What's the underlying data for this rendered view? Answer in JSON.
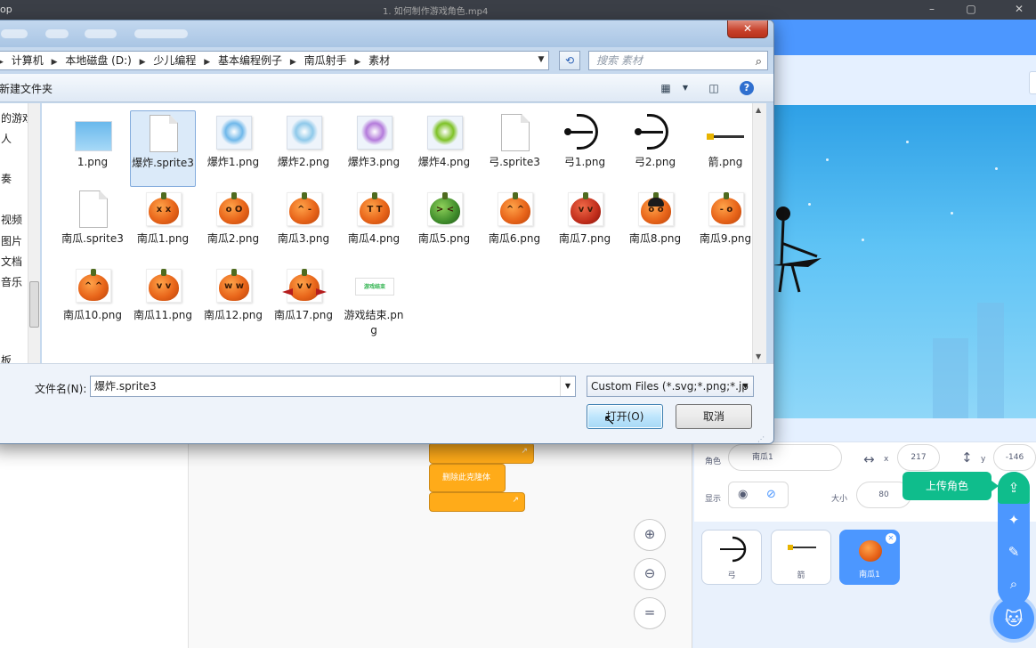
{
  "window": {
    "app_title_fragment": "op",
    "title_blurred": "1. 如何制作游戏角色.mp4"
  },
  "dialog": {
    "close_label": "✕",
    "breadcrumbs": [
      "计算机",
      "本地磁盘 (D:)",
      "少儿编程",
      "基本编程例子",
      "南瓜射手",
      "素材"
    ],
    "search_placeholder": "搜索 素材",
    "new_folder_label": "新建文件夹",
    "nav_items": [
      "的游戏",
      "人",
      "奏",
      "视频",
      "图片",
      "文档",
      "音乐",
      "板"
    ],
    "files": [
      {
        "name": "1.png",
        "kind": "sky"
      },
      {
        "name": "爆炸.sprite3",
        "kind": "doc",
        "selected": true
      },
      {
        "name": "爆炸1.png",
        "kind": "splash",
        "color": "#6fb8ea"
      },
      {
        "name": "爆炸2.png",
        "kind": "splash",
        "color": "#8ec9ea"
      },
      {
        "name": "爆炸3.png",
        "kind": "splash",
        "color": "#b47bdb"
      },
      {
        "name": "爆炸4.png",
        "kind": "splash",
        "color": "#7ec226"
      },
      {
        "name": "弓.sprite3",
        "kind": "doc"
      },
      {
        "name": "弓1.png",
        "kind": "bow"
      },
      {
        "name": "弓2.png",
        "kind": "bow"
      },
      {
        "name": "箭.png",
        "kind": "arrow"
      },
      {
        "name": "南瓜.sprite3",
        "kind": "doc"
      },
      {
        "name": "南瓜1.png",
        "kind": "pumpkin",
        "face": "x x"
      },
      {
        "name": "南瓜2.png",
        "kind": "pumpkin",
        "face": "o O"
      },
      {
        "name": "南瓜3.png",
        "kind": "pumpkin",
        "face": "^ -"
      },
      {
        "name": "南瓜4.png",
        "kind": "pumpkin",
        "face": "T T"
      },
      {
        "name": "南瓜5.png",
        "kind": "pumpkin-green",
        "face": "> <"
      },
      {
        "name": "南瓜6.png",
        "kind": "pumpkin",
        "face": "^ ^"
      },
      {
        "name": "南瓜7.png",
        "kind": "pumpkin-red",
        "face": "v v"
      },
      {
        "name": "南瓜8.png",
        "kind": "pumpkin-hat",
        "face": "o o"
      },
      {
        "name": "南瓜9.png",
        "kind": "pumpkin",
        "face": "- o"
      },
      {
        "name": "南瓜10.png",
        "kind": "pumpkin",
        "face": "^ ^"
      },
      {
        "name": "南瓜11.png",
        "kind": "pumpkin",
        "face": "v v"
      },
      {
        "name": "南瓜12.png",
        "kind": "pumpkin",
        "face": "w w"
      },
      {
        "name": "南瓜17.png",
        "kind": "pumpkin-bat",
        "face": "v v"
      },
      {
        "name": "游戏结束.png",
        "kind": "endgame",
        "thumb_text": "游戏结束"
      }
    ],
    "filename_label": "文件名(N):",
    "filename_value": "爆炸.sprite3",
    "filetype_value": "Custom Files (*.svg;*.png;*.jp",
    "open_label": "打开(O)",
    "cancel_label": "取消"
  },
  "scratch": {
    "sprite_label": "角色",
    "sprite_name": "南瓜1",
    "x_label": "x",
    "x_value": "217",
    "y_label": "y",
    "y_value": "-146",
    "show_label": "显示",
    "size_label": "大小",
    "size_value": "80",
    "upload_tooltip": "上传角色",
    "block_label": "删除此克隆体",
    "sprites": [
      {
        "name": "弓",
        "selected": false
      },
      {
        "name": "箭",
        "selected": false
      },
      {
        "name": "南瓜1",
        "selected": true
      }
    ],
    "colors": {
      "blue": "#4c97ff",
      "green": "#0fbd8c",
      "orange": "#ffab19"
    }
  }
}
